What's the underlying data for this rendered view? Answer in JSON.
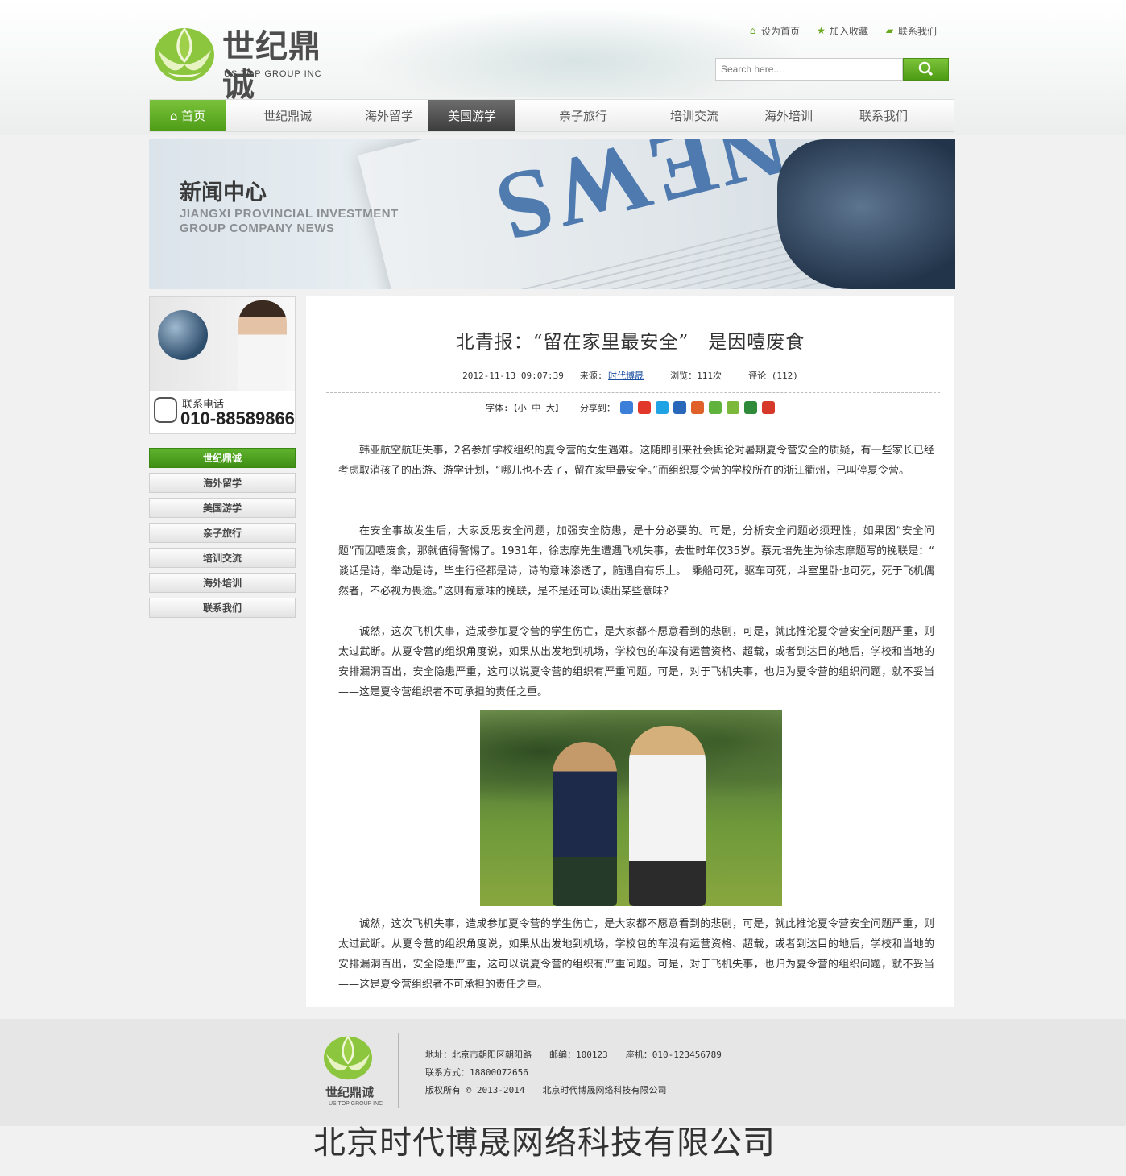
{
  "header": {
    "logo_cn": "世纪鼎诚",
    "logo_en": "US TOP GROUP INC",
    "links": [
      {
        "label": "设为首页",
        "icon": "home-icon"
      },
      {
        "label": "加入收藏",
        "icon": "star-icon"
      },
      {
        "label": "联系我们",
        "icon": "chat-icon"
      }
    ],
    "search_placeholder": "Search here...",
    "accent": "#5aa91f"
  },
  "nav": {
    "items": [
      {
        "label": "首页",
        "state": "home"
      },
      {
        "label": "世纪鼎诚",
        "state": ""
      },
      {
        "label": "海外留学",
        "state": ""
      },
      {
        "label": "美国游学",
        "state": "active"
      },
      {
        "label": "亲子旅行",
        "state": ""
      },
      {
        "label": "培训交流",
        "state": ""
      },
      {
        "label": "海外培训",
        "state": ""
      },
      {
        "label": "联系我们",
        "state": ""
      }
    ]
  },
  "banner": {
    "title": "新闻中心",
    "sub1": "JIANGXI PROVINCIAL INVESTMENT",
    "sub2": "GROUP COMPANY NEWS"
  },
  "sidebar": {
    "tel_label": "联系电话",
    "tel_number": "010-88589866",
    "menu": [
      "世纪鼎诚",
      "海外留学",
      "美国游学",
      "亲子旅行",
      "培训交流",
      "海外培训",
      "联系我们"
    ]
  },
  "article": {
    "title": "北青报：“留在家里最安全”　是因噎废食",
    "date": "2012-11-13 09:07:39",
    "source_label": "来源:",
    "source": "时代博晟",
    "views": "浏览：111次",
    "comments": "评论 (112)",
    "font_label": "字体:【小 中 大】",
    "share_label": "分享到：",
    "paragraphs": [
      "韩亚航空航班失事，2名参加学校组织的夏令营的女生遇难。这随即引来社会舆论对暑期夏令营安全的质疑，有一些家长已经考虑取消孩子的出游、游学计划，“哪儿也不去了，留在家里最安全。”而组织夏令营的学校所在的浙江衢州，已叫停夏令营。",
      "在安全事故发生后，大家反思安全问题，加强安全防患，是十分必要的。可是，分析安全问题必须理性，如果因“安全问题”而因噎废食，那就值得警惕了。1931年，徐志摩先生遭遇飞机失事，去世时年仅35岁。蔡元培先生为徐志摩题写的挽联是：“　谈话是诗，举动是诗，毕生行径都是诗，诗的意味渗透了，随遇自有乐土。　乘船可死，驱车可死，斗室里卧也可死，死于飞机偶然者，不必视为畏途。”这则有意味的挽联，是不是还可以读出某些意味？",
      "诚然，这次飞机失事，造成参加夏令营的学生伤亡，是大家都不愿意看到的悲剧，可是，就此推论夏令营安全问题严重，则太过武断。从夏令营的组织角度说，如果从出发地到机场，学校包的车没有运营资格、超载，或者到达目的地后，学校和当地的安排漏洞百出，安全隐患严重，这可以说夏令营的组织有严重问题。可是，对于飞机失事，也归为夏令营的组织问题，就不妥当——这是夏令营组织者不可承担的责任之重。",
      "诚然，这次飞机失事，造成参加夏令营的学生伤亡，是大家都不愿意看到的悲剧，可是，就此推论夏令营安全问题严重，则太过武断。从夏令营的组织角度说，如果从出发地到机场，学校包的车没有运营资格、超载，或者到达目的地后，学校和当地的安排漏洞百出，安全隐患严重，这可以说夏令营的组织有严重问题。可是，对于飞机失事，也归为夏令营的组织问题，就不妥当——这是夏令营组织者不可承担的责任之重。"
    ]
  },
  "footer": {
    "logo_cn": "世纪鼎诚",
    "logo_en": "US TOP GROUP INC",
    "line1": "地址：北京市朝阳区朝阳路　　邮编：100123　　座机：010-123456789",
    "line2": "联系方式：18800072656",
    "line3": "版权所有 © 2013-2014　　北京时代博晟网络科技有限公司",
    "company": "北京时代博晟网络科技有限公司"
  }
}
